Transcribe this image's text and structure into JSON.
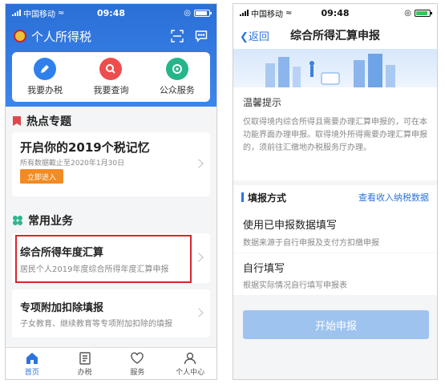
{
  "phone1": {
    "status": {
      "carrier": "中国移动",
      "time": "09:48"
    },
    "app_title": "个人所得税",
    "quick": [
      {
        "label": "我要办税",
        "color": "#2f80ed"
      },
      {
        "label": "我要查询",
        "color": "#ee4d4d"
      },
      {
        "label": "公众服务",
        "color": "#25b58a"
      }
    ],
    "hot": {
      "title": "热点专题",
      "promo_title": "开启你的2019个税记忆",
      "promo_sub": "所有数据截止至2020年1月30日",
      "promo_button": "立即进入"
    },
    "business": {
      "title": "常用业务",
      "items": [
        {
          "title": "综合所得年度汇算",
          "sub": "居民个人2019年度综合所得年度汇算申报"
        },
        {
          "title": "专项附加扣除填报",
          "sub": "子女教育、继续教育等专项附加扣除的填报"
        }
      ]
    },
    "tabs": [
      "首页",
      "办税",
      "服务",
      "个人中心"
    ]
  },
  "phone2": {
    "status": {
      "carrier": "中国移动",
      "time": "09:48"
    },
    "back_label": "返回",
    "title": "综合所得汇算申报",
    "notice_title": "温馨提示",
    "notice_body": "仅取得境内综合所得且需要办理汇算申报的，可在本功能界面办理申报。取得境外所得需要办理汇算申报的，须前往汇缴地办税服务厅办理。",
    "method_title": "填报方式",
    "method_link": "查看收入纳税数据",
    "options": [
      {
        "title": "使用已申报数据填写",
        "sub": "数据来源于自行申报及支付方扣缴申报"
      },
      {
        "title": "自行填写",
        "sub": "根据实际情况自行填写申报表"
      }
    ],
    "start_button": "开始申报"
  },
  "colors": {
    "primary": "#2c74dd",
    "highlight": "#d9252b",
    "promo": "#f28b22"
  }
}
